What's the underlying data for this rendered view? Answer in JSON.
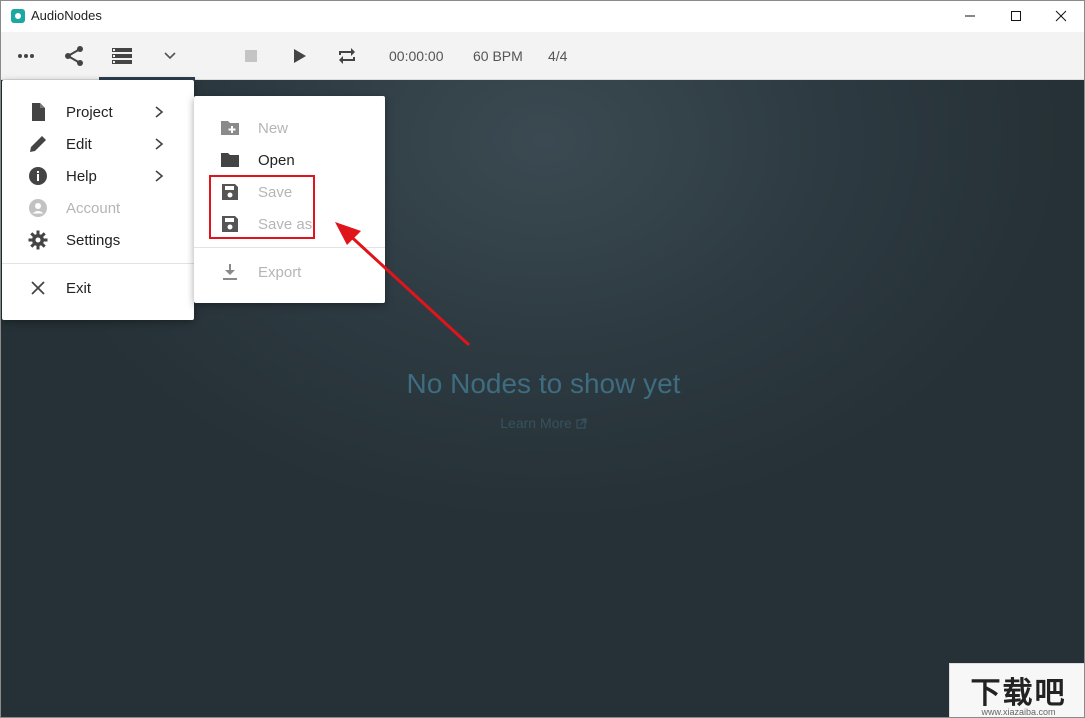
{
  "window": {
    "title": "AudioNodes",
    "colors": {
      "accent": "#1aa8a0",
      "highlight_red": "#e0141b",
      "canvas_bg": "#2d3a41"
    }
  },
  "toolbar": {
    "time": "00:00:00",
    "bpm": "60 BPM",
    "signature": "4/4"
  },
  "main_menu": {
    "items": [
      {
        "label": "Project",
        "icon": "file-icon",
        "has_submenu": true,
        "disabled": false
      },
      {
        "label": "Edit",
        "icon": "pencil-icon",
        "has_submenu": true,
        "disabled": false
      },
      {
        "label": "Help",
        "icon": "info-icon",
        "has_submenu": true,
        "disabled": false
      },
      {
        "label": "Account",
        "icon": "account-icon",
        "has_submenu": false,
        "disabled": true
      },
      {
        "label": "Settings",
        "icon": "gear-icon",
        "has_submenu": false,
        "disabled": false
      }
    ],
    "exit_label": "Exit"
  },
  "project_submenu": {
    "items": [
      {
        "label": "New",
        "icon": "folder-plus-icon",
        "disabled": true
      },
      {
        "label": "Open",
        "icon": "folder-icon",
        "disabled": false
      },
      {
        "label": "Save",
        "icon": "save-icon",
        "disabled": true
      },
      {
        "label": "Save as",
        "icon": "save-as-icon",
        "disabled": true
      }
    ],
    "export_label": "Export"
  },
  "canvas": {
    "empty_title": "No Nodes to show yet",
    "learn_more": "Learn More"
  },
  "watermark": {
    "text": "下载吧",
    "url": "www.xiazaiba.com"
  }
}
